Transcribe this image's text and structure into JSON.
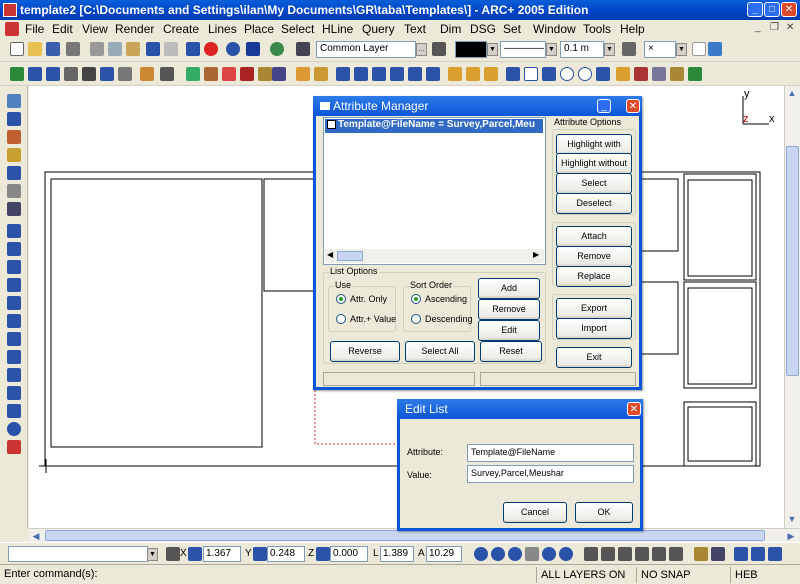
{
  "window": {
    "title": "template2 [C:\\Documents and Settings\\ilan\\My Documents\\GR\\taba\\Templates\\] - ARC+ 2005 Edition",
    "minimize": "_",
    "maximize": "□",
    "close": "✕"
  },
  "menu": {
    "items": [
      "File",
      "Edit",
      "View",
      "Render",
      "Create",
      "Lines",
      "Place",
      "Select",
      "HLine",
      "Query",
      "Text",
      "Dim",
      "DSG",
      "Set",
      "Window",
      "Tools",
      "Help"
    ],
    "mdi_minimize": "_",
    "mdi_restore": "❐",
    "mdi_close": "✕"
  },
  "toolbar": {
    "layer_value": "Common Layer",
    "line_width_value": "0.1 m",
    "pattern_value": "×"
  },
  "axes": {
    "y_label": "y",
    "x_label": "x",
    "z_label": "z"
  },
  "attribute_manager": {
    "title": "Attribute Manager",
    "list_item": "Template@FileName = Survey,Parcel,Meu",
    "attribute_options_label": "Attribute Options",
    "btn_highlight_with": "Highlight with",
    "btn_highlight_without": "Highlight without",
    "btn_select": "Select",
    "btn_deselect": "Deselect",
    "btn_attach": "Attach",
    "btn_remove_right": "Remove",
    "btn_replace": "Replace",
    "btn_export": "Export",
    "btn_import": "Import",
    "btn_exit": "Exit",
    "list_options_label": "List Options",
    "use_label": "Use",
    "radio_attr_only": "Attr. Only",
    "radio_attr_value": "Attr.+ Value",
    "sort_order_label": "Sort Order",
    "radio_ascending": "Ascending",
    "radio_descending": "Descending",
    "btn_add": "Add",
    "btn_remove": "Remove",
    "btn_edit": "Edit",
    "btn_reverse": "Reverse",
    "btn_select_all": "Select All",
    "btn_reset": "Reset"
  },
  "edit_list": {
    "title": "Edit List",
    "attribute_label": "Attribute:",
    "attribute_value": "Template@FileName",
    "value_label": "Value:",
    "value_value": "Survey,Parcel,Meushar",
    "btn_cancel": "Cancel",
    "btn_ok": "OK"
  },
  "coords": {
    "x_label": "X",
    "x_value": "1.367",
    "y_label": "Y",
    "y_value": "0.248",
    "z_label": "Z",
    "z_value": "0.000",
    "l_label": "L",
    "l_value": "1.389",
    "a_label": "A",
    "a_value": "10.29"
  },
  "status": {
    "command": "Enter command(s):",
    "layers": "ALL LAYERS ON",
    "snap": "NO SNAP",
    "lang": "HEB"
  }
}
